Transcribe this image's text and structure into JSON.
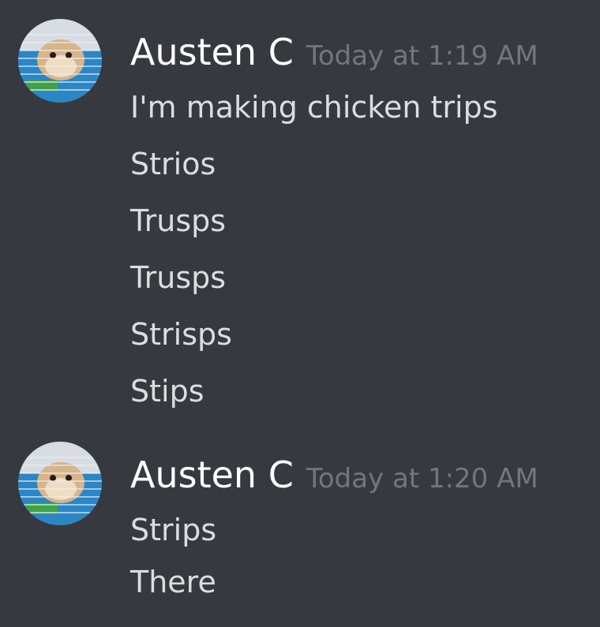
{
  "messages": [
    {
      "author": "Austen C",
      "timestamp": "Today at 1:19 AM",
      "avatar_icon": "hamster-avatar-icon",
      "lines": [
        "I'm making chicken trips",
        "Strios",
        "Trusps",
        "Trusps",
        "Strisps",
        "Stips"
      ]
    },
    {
      "author": "Austen C",
      "timestamp": "Today at 1:20 AM",
      "avatar_icon": "hamster-avatar-icon",
      "lines": [
        "Strips",
        "There"
      ]
    }
  ],
  "colors": {
    "background": "#36393f",
    "username": "#ffffff",
    "timestamp": "#72767d",
    "message_text": "#dcddde"
  }
}
